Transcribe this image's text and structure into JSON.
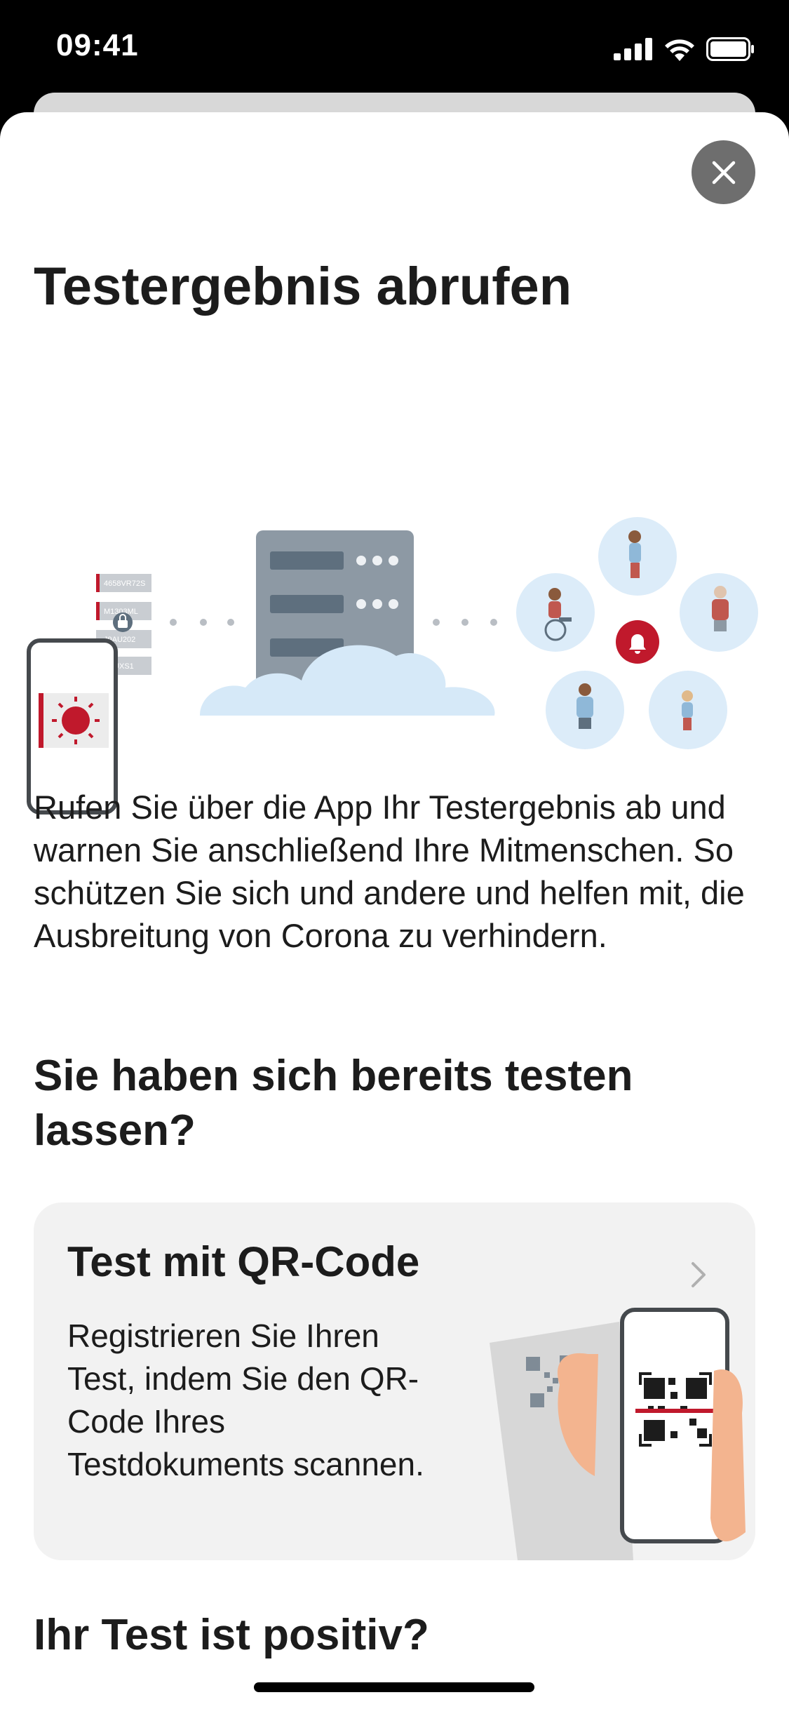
{
  "status": {
    "time": "09:41"
  },
  "header": {
    "title": "Testergebnis abrufen",
    "close_icon": "close-icon"
  },
  "illustration": {
    "codes": [
      "4658VR72S",
      "M1303ML",
      "J9AU202",
      "4DUXS1"
    ]
  },
  "intro": "Rufen Sie über die App Ihr Testergebnis ab und warnen Sie anschließend Ihre Mitmenschen. So schützen Sie sich und andere und helfen mit, die Ausbreitung von Corona zu verhindern.",
  "section1": {
    "heading": "Sie haben sich bereits testen lassen?"
  },
  "qr_card": {
    "title": "Test mit QR-Code",
    "description": "Registrieren Sie Ihren Test, indem Sie den QR-Code Ihres Testdokuments scannen.",
    "icon": "chevron-right-icon"
  },
  "section2": {
    "heading": "Ihr Test ist positiv?"
  },
  "colors": {
    "accent": "#c0192c",
    "card_bg": "#f2f2f2",
    "close_bg": "#6e6e6e"
  }
}
